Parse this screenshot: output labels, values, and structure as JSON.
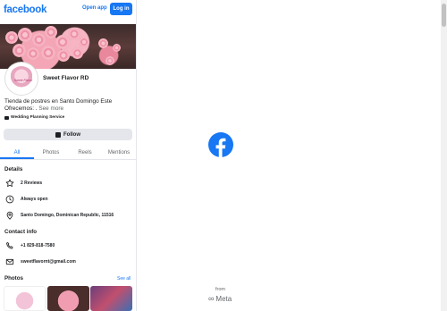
{
  "header": {
    "brand": "facebook",
    "open_app": "Open app",
    "login": "Log in"
  },
  "page": {
    "name": "Sweet Flavor RD",
    "avatar_text": "Sweet Flavor",
    "bio_line1": "Tienda de postres en Santo Domingo Este",
    "bio_line2": "Ofrecemos: . ",
    "see_more": "See more",
    "category": "Wedding Planning Service",
    "follow": "Follow"
  },
  "tabs": [
    "All",
    "Photos",
    "Reels",
    "Mentions"
  ],
  "details": {
    "title": "Details",
    "reviews": "2 Reviews",
    "hours": "Always open",
    "address": "Santo Domingo, Dominican Republic, 11516"
  },
  "contact": {
    "title": "Contact info",
    "phone": "+1 829-818-7580",
    "email": "sweetflavornt@gmail.com"
  },
  "photos": {
    "title": "Photos",
    "see_all": "See all"
  },
  "footer": {
    "from": "from",
    "meta": "Meta"
  },
  "colors": {
    "brand": "#1877f2",
    "text": "#1c1e21",
    "muted": "#65676b",
    "button_bg": "#e4e6eb"
  }
}
